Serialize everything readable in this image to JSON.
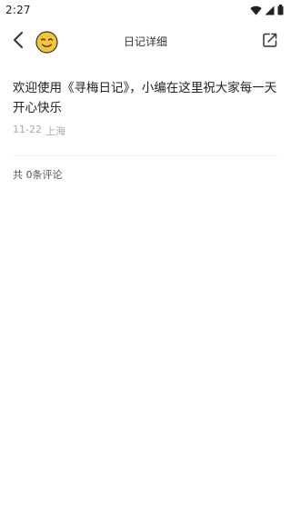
{
  "status_bar": {
    "time": "2:27"
  },
  "header": {
    "title": "日记详细",
    "back_icon": "chevron-left-icon",
    "mood_icon": "smiling-face-icon",
    "share_icon": "share-icon"
  },
  "diary": {
    "text": "欢迎使用《寻梅日记》，小编在这里祝大家每一天开心快乐",
    "date": "11-22",
    "location": "上海"
  },
  "comments": {
    "count_label": "共 0条评论"
  },
  "colors": {
    "emoji_yellow": "#F7C531",
    "text_primary": "#222222",
    "text_secondary": "#AAAAAA"
  }
}
